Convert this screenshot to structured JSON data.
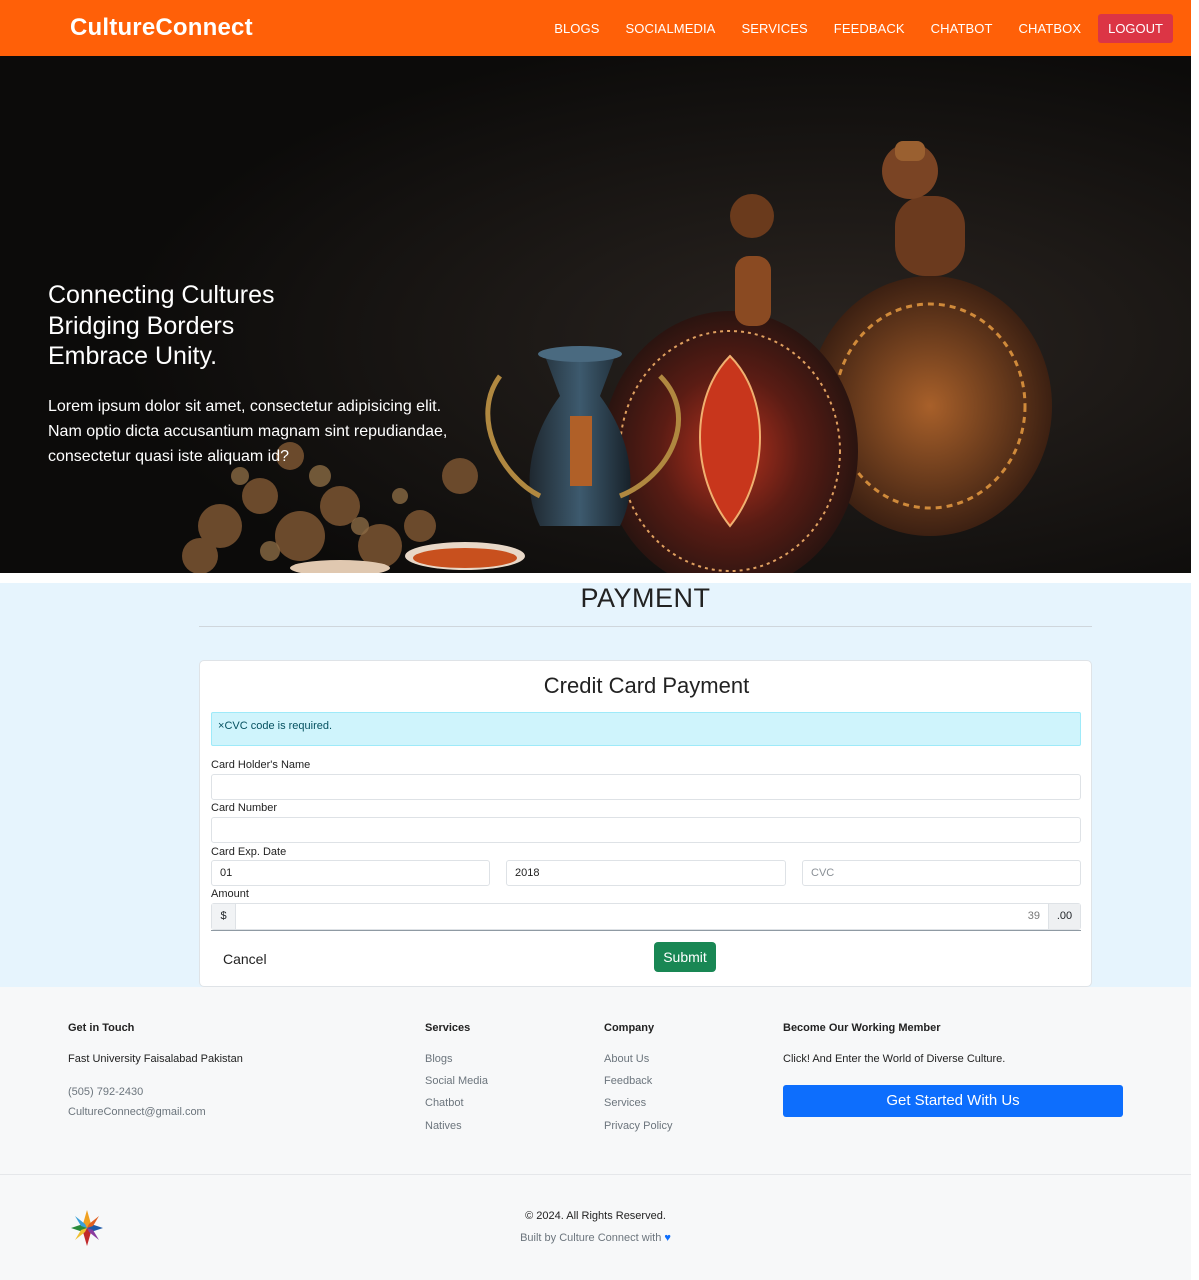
{
  "navbar": {
    "brand": "CultureConnect",
    "links": [
      "BLOGS",
      "SOCIALMEDIA",
      "SERVICES",
      "FEEDBACK",
      "CHATBOT",
      "CHATBOX"
    ],
    "logout_label": "LOGOUT",
    "bg_color": "#ff6008"
  },
  "hero": {
    "title_lines": [
      "Connecting Cultures",
      "Bridging Borders",
      "Embrace Unity."
    ],
    "text": "Lorem ipsum dolor sit amet, consectetur adipisicing elit. Nam optio dicta accusantium magnam sint repudiandae, consectetur quasi iste aliquam id?"
  },
  "payment": {
    "heading": "PAYMENT",
    "card_title": "Credit Card Payment",
    "alert_close": "×",
    "alert_text": "CVC code is required.",
    "name_label": "Card Holder's Name",
    "name_value": "",
    "number_label": "Card Number",
    "number_value": "",
    "exp_label": "Card Exp. Date",
    "exp_month": "01",
    "exp_year": "2018",
    "cvc_placeholder": "CVC",
    "amount_label": "Amount",
    "currency_symbol": "$",
    "amount_value": "39",
    "amount_suffix": ".00",
    "cancel_label": "Cancel",
    "submit_label": "Submit",
    "submit_color": "#198754"
  },
  "footer": {
    "contact": {
      "heading": "Get in Touch",
      "address": "Fast University Faisalabad Pakistan",
      "phone": "(505) 792-2430",
      "email": "CultureConnect@gmail.com"
    },
    "services": {
      "heading": "Services",
      "links": [
        "Blogs",
        "Social Media",
        "Chatbot",
        "Natives"
      ]
    },
    "company": {
      "heading": "Company",
      "links": [
        "About Us",
        "Feedback",
        "Services",
        "Privacy Policy"
      ]
    },
    "member": {
      "heading": "Become Our Working Member",
      "text": "Click! And Enter the World of Diverse Culture.",
      "cta_label": "Get Started With Us",
      "cta_color": "#0d6efd"
    },
    "copyright": "© 2024. All Rights Reserved.",
    "built_by": "Built by Culture Connect with",
    "heart": "♥"
  }
}
